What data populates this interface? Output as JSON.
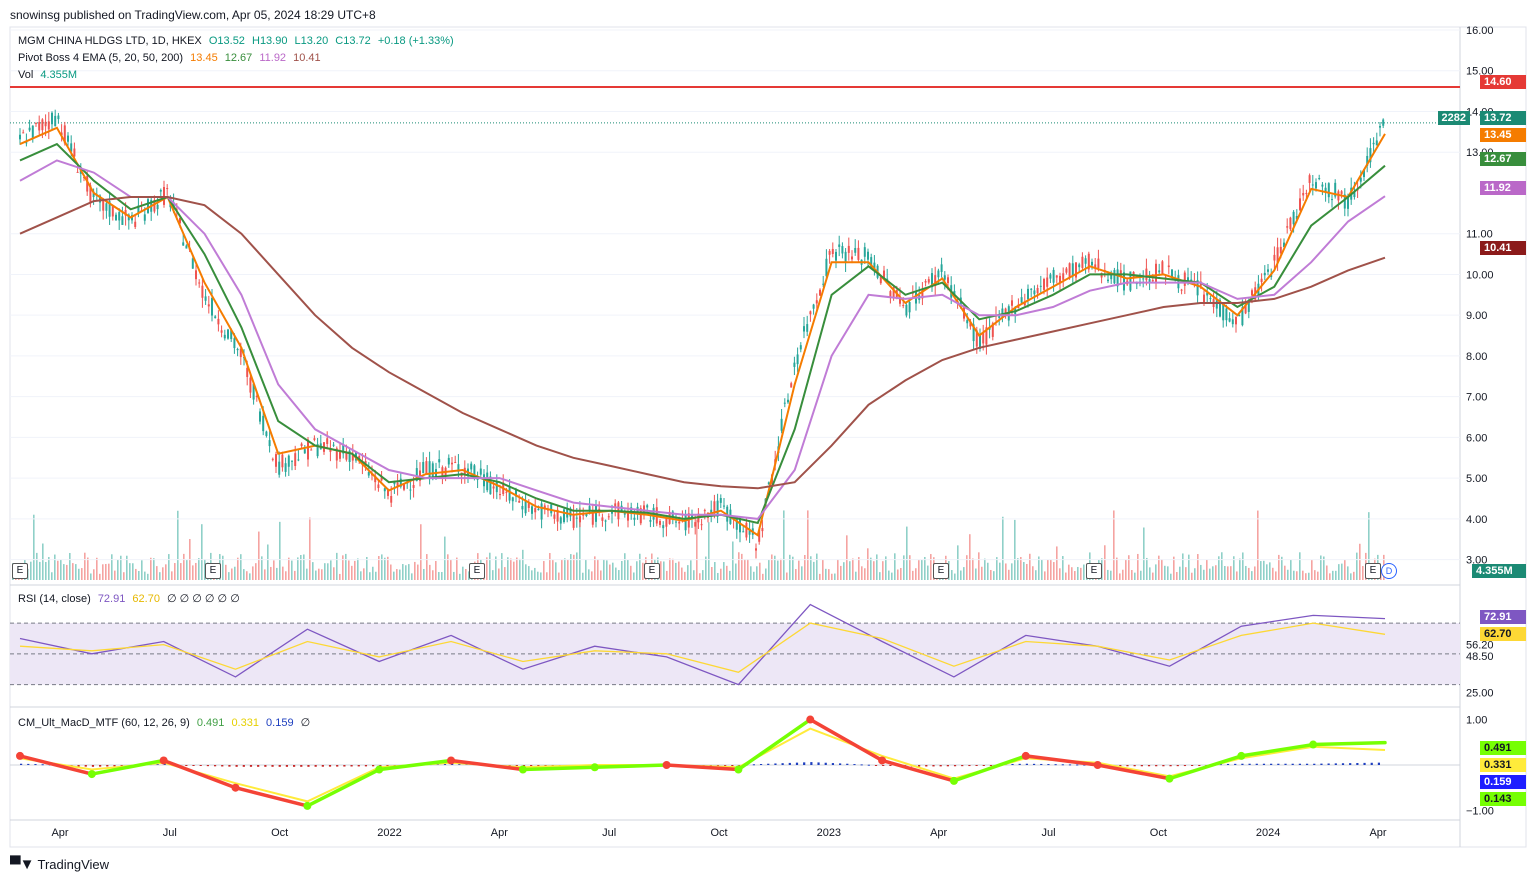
{
  "header": {
    "publisher": "snowinsg published on TradingView.com, Apr 05, 2024 18:29 UTC+8"
  },
  "brand": {
    "name": "TradingView",
    "logo_icon": "tradingview-logo-icon"
  },
  "legend": {
    "symbol": "MGM CHINA HLDGS LTD, 1D, HKEX",
    "open": "O13.52",
    "high": "H13.90",
    "low": "L13.20",
    "close": "C13.72",
    "change": "+0.18 (+1.33%)",
    "ema_title": "Pivot Boss 4 EMA (5, 20, 50, 200)",
    "ema_values": [
      "13.45",
      "12.67",
      "11.92",
      "10.41"
    ],
    "vol_title": "Vol",
    "vol_value": "4.355M",
    "rsi_title": "RSI (14, close)",
    "rsi_value": "72.91",
    "rsi_ma": "62.70",
    "rsi_zeros": "∅ ∅ ∅ ∅ ∅ ∅",
    "macd_title": "CM_Ult_MacD_MTF (60, 12, 26, 9)",
    "macd_values": [
      "0.491",
      "0.331",
      "0.159"
    ],
    "macd_zero": "∅"
  },
  "price_axis": {
    "ticks": [
      "16.00",
      "15.00",
      "14.00",
      "13.00",
      "11.00",
      "10.00",
      "9.00",
      "8.00",
      "7.00",
      "6.00",
      "5.00",
      "4.00",
      "3.00"
    ]
  },
  "rsi_axis": {
    "ticks": [
      "56.20",
      "48.50",
      "25.00"
    ]
  },
  "macd_axis": {
    "ticks": [
      "1.00",
      "−1.00"
    ]
  },
  "time_axis": {
    "labels": [
      "Apr",
      "Jul",
      "Oct",
      "2022",
      "Apr",
      "Jul",
      "Oct",
      "2023",
      "Apr",
      "Jul",
      "Oct",
      "2024",
      "Apr"
    ]
  },
  "price_labels": {
    "resistance": "14.60",
    "countdown": "2282",
    "last": "13.72",
    "ema5": "13.45",
    "ema20": "12.67",
    "ema50": "11.92",
    "ema200": "10.41",
    "volume": "4.355M"
  },
  "rsi_labels": {
    "rsi": "72.91",
    "ma": "62.70"
  },
  "macd_labels": {
    "macd": "0.491",
    "signal": "0.331",
    "hist": "0.159",
    "other": "0.143"
  },
  "events": {
    "earnings_label": "E",
    "dividend_label": "D"
  },
  "colors": {
    "up": "#26a69a",
    "down": "#ef5350",
    "ema5": "#f57c00",
    "ema20": "#388e3c",
    "ema50": "#c07cd6",
    "ema200": "#a0524a",
    "resistance": "#e53935",
    "rsi": "#7e57c2",
    "rsi_ma": "#fdd835",
    "rsi_band": "#ede7f6",
    "macd_up": "#76ff03",
    "macd_down": "#f44336",
    "signal": "#ffeb3b"
  },
  "chart_data": [
    {
      "type": "line",
      "title": "MGM CHINA HLDGS LTD, 1D, HKEX",
      "x": [
        "2021-03",
        "2021-04",
        "2021-05",
        "2021-06",
        "2021-07",
        "2021-08",
        "2021-09",
        "2021-10",
        "2021-11",
        "2021-12",
        "2022-01",
        "2022-02",
        "2022-03",
        "2022-04",
        "2022-05",
        "2022-06",
        "2022-07",
        "2022-08",
        "2022-09",
        "2022-10",
        "2022-11",
        "2022-12",
        "2023-01",
        "2023-02",
        "2023-03",
        "2023-04",
        "2023-05",
        "2023-06",
        "2023-07",
        "2023-08",
        "2023-09",
        "2023-10",
        "2023-11",
        "2023-12",
        "2024-01",
        "2024-02",
        "2024-03",
        "2024-04"
      ],
      "series": [
        {
          "name": "Close",
          "values": [
            13.3,
            13.9,
            11.8,
            11.3,
            12.0,
            9.5,
            8.0,
            5.3,
            5.8,
            5.6,
            4.6,
            5.2,
            5.3,
            4.7,
            4.2,
            4.0,
            4.2,
            4.1,
            3.9,
            4.3,
            3.4,
            7.8,
            10.6,
            10.4,
            9.2,
            10.1,
            8.3,
            9.3,
            9.9,
            10.3,
            9.8,
            10.1,
            9.6,
            8.8,
            10.3,
            12.4,
            11.8,
            13.72
          ]
        },
        {
          "name": "EMA 5",
          "values": [
            13.2,
            13.6,
            12.0,
            11.4,
            11.9,
            9.8,
            8.2,
            5.6,
            5.8,
            5.6,
            4.7,
            5.1,
            5.2,
            4.8,
            4.3,
            4.1,
            4.2,
            4.1,
            3.95,
            4.2,
            3.6,
            7.3,
            10.3,
            10.3,
            9.3,
            9.9,
            8.5,
            9.2,
            9.7,
            10.2,
            9.9,
            10.0,
            9.7,
            9.0,
            10.1,
            12.1,
            11.9,
            13.45
          ]
        },
        {
          "name": "EMA 20",
          "values": [
            12.8,
            13.2,
            12.3,
            11.6,
            11.9,
            10.5,
            8.7,
            6.4,
            5.8,
            5.6,
            4.9,
            5.0,
            5.1,
            4.9,
            4.5,
            4.2,
            4.2,
            4.15,
            4.0,
            4.1,
            3.9,
            6.2,
            9.5,
            10.2,
            9.5,
            9.8,
            8.9,
            9.1,
            9.5,
            10.0,
            10.0,
            9.9,
            9.8,
            9.2,
            9.7,
            11.2,
            11.9,
            12.67
          ]
        },
        {
          "name": "EMA 50",
          "values": [
            12.3,
            12.8,
            12.5,
            11.9,
            11.9,
            11.0,
            9.5,
            7.3,
            6.2,
            5.7,
            5.2,
            5.0,
            5.0,
            5.0,
            4.7,
            4.4,
            4.3,
            4.2,
            4.1,
            4.1,
            4.0,
            5.2,
            8.0,
            9.5,
            9.4,
            9.5,
            9.0,
            9.0,
            9.2,
            9.6,
            9.8,
            9.8,
            9.8,
            9.4,
            9.5,
            10.3,
            11.3,
            11.92
          ]
        },
        {
          "name": "EMA 200",
          "values": [
            11.0,
            11.4,
            11.8,
            11.9,
            11.9,
            11.7,
            11.0,
            10.0,
            9.0,
            8.2,
            7.6,
            7.1,
            6.6,
            6.2,
            5.8,
            5.5,
            5.3,
            5.1,
            4.9,
            4.8,
            4.75,
            4.9,
            5.8,
            6.8,
            7.4,
            7.9,
            8.2,
            8.4,
            8.6,
            8.8,
            9.0,
            9.2,
            9.3,
            9.3,
            9.4,
            9.7,
            10.1,
            10.41
          ]
        }
      ],
      "reference_line": 14.6,
      "ylim": [
        2.5,
        16.0
      ]
    },
    {
      "type": "line",
      "title": "RSI (14, close)",
      "x": [
        "2021-03",
        "2021-05",
        "2021-07",
        "2021-09",
        "2021-11",
        "2022-01",
        "2022-03",
        "2022-05",
        "2022-07",
        "2022-09",
        "2022-11",
        "2023-01",
        "2023-03",
        "2023-05",
        "2023-07",
        "2023-09",
        "2023-11",
        "2024-01",
        "2024-03",
        "2024-04"
      ],
      "series": [
        {
          "name": "RSI",
          "values": [
            60,
            50,
            58,
            35,
            66,
            45,
            62,
            40,
            55,
            48,
            30,
            82,
            58,
            35,
            62,
            55,
            42,
            68,
            75,
            72.91
          ]
        },
        {
          "name": "MA",
          "values": [
            55,
            52,
            56,
            40,
            58,
            48,
            58,
            45,
            52,
            50,
            38,
            70,
            60,
            42,
            58,
            55,
            46,
            62,
            70,
            62.7
          ]
        }
      ],
      "ylim": [
        20,
        85
      ]
    },
    {
      "type": "line",
      "title": "CM_Ult_MacD_MTF (60, 12, 26, 9)",
      "x": [
        "2021-03",
        "2021-05",
        "2021-07",
        "2021-09",
        "2021-11",
        "2022-01",
        "2022-03",
        "2022-05",
        "2022-07",
        "2022-09",
        "2022-11",
        "2023-01",
        "2023-03",
        "2023-05",
        "2023-07",
        "2023-09",
        "2023-11",
        "2024-01",
        "2024-03",
        "2024-04"
      ],
      "series": [
        {
          "name": "MACD",
          "values": [
            0.2,
            -0.2,
            0.1,
            -0.5,
            -0.9,
            -0.1,
            0.1,
            -0.1,
            -0.05,
            0.0,
            -0.1,
            1.0,
            0.1,
            -0.35,
            0.2,
            0.0,
            -0.3,
            0.2,
            0.45,
            0.491
          ]
        },
        {
          "name": "Signal",
          "values": [
            0.15,
            -0.1,
            0.05,
            -0.4,
            -0.8,
            -0.05,
            0.05,
            -0.05,
            0.0,
            0.0,
            -0.05,
            0.8,
            0.2,
            -0.3,
            0.15,
            0.05,
            -0.25,
            0.15,
            0.4,
            0.331
          ]
        }
      ],
      "ylim": [
        -1.1,
        1.1
      ]
    }
  ]
}
